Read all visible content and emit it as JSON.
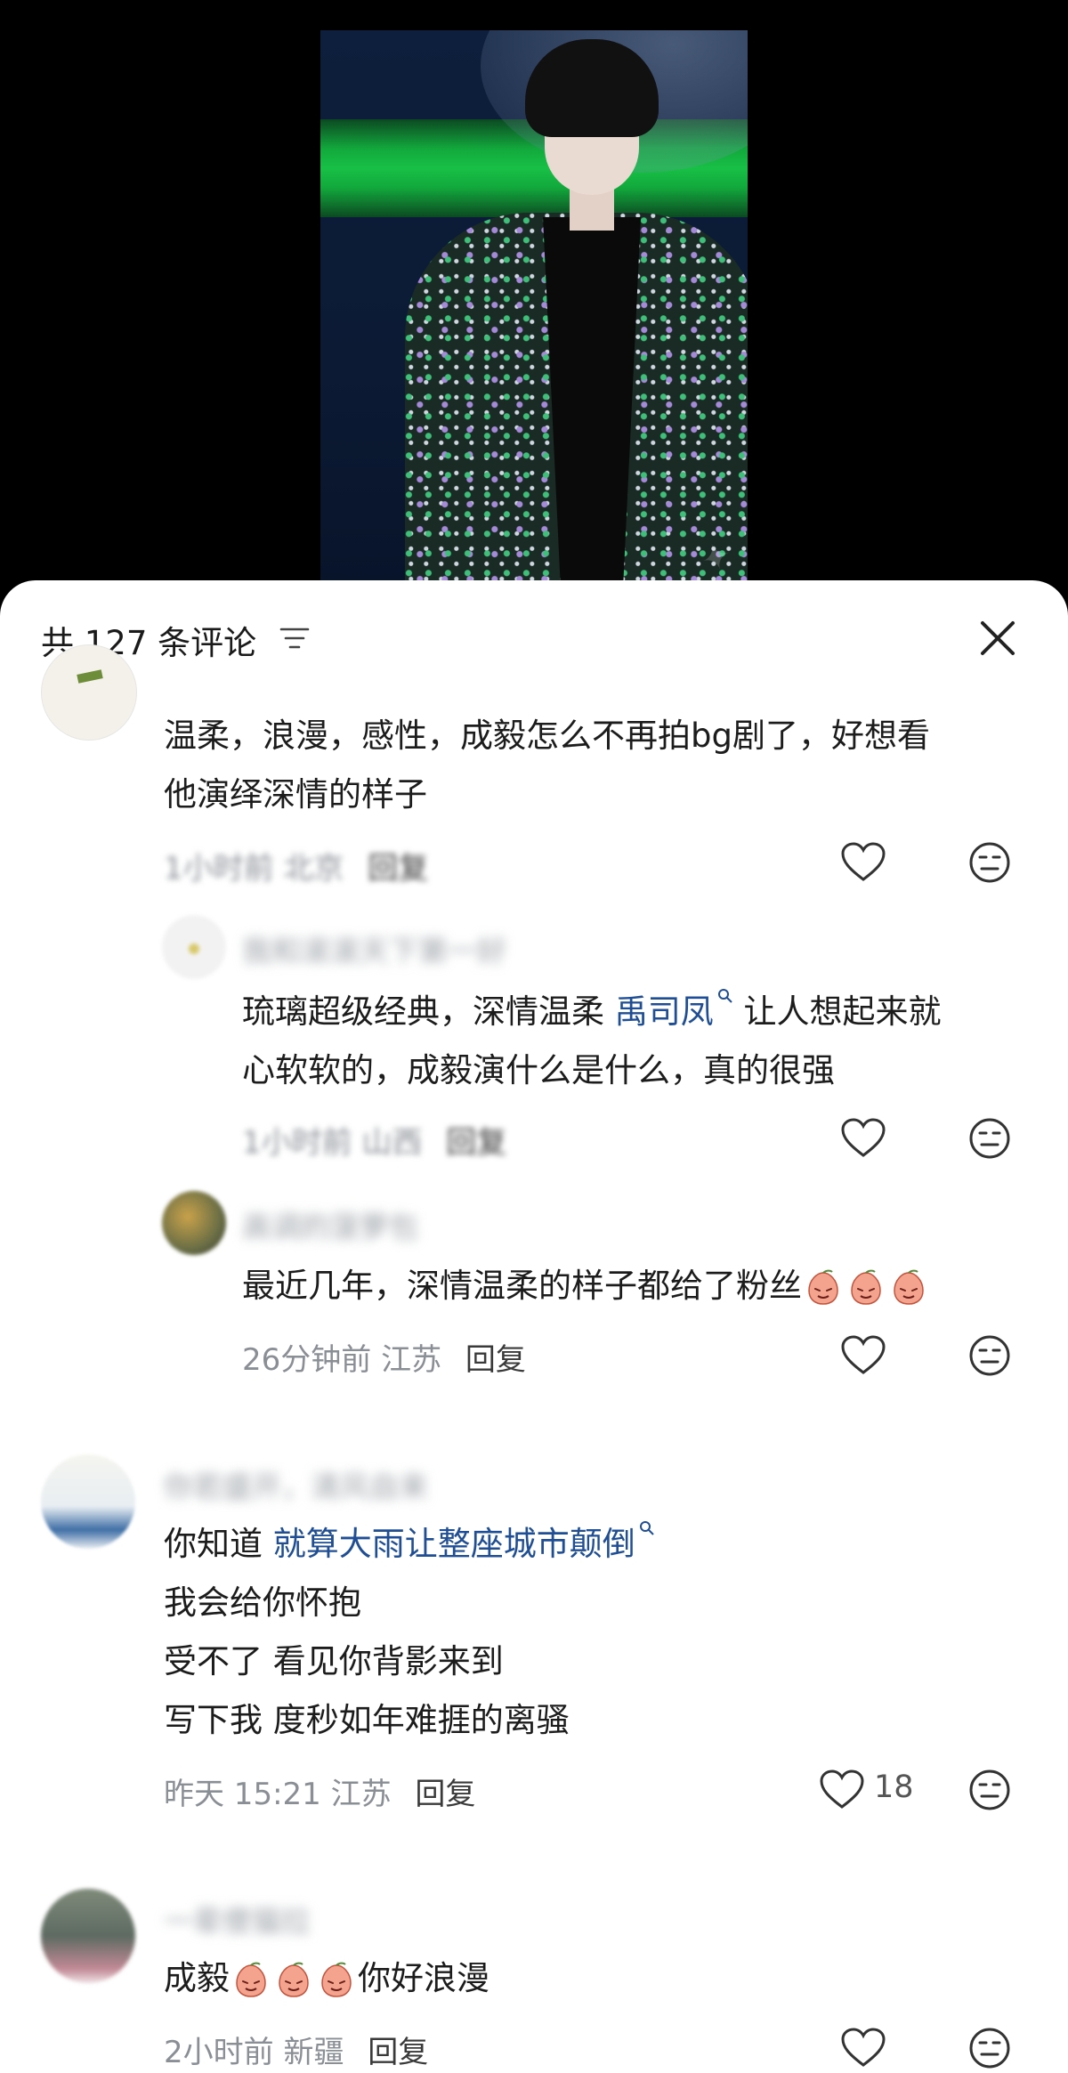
{
  "header": {
    "title": "共 127 条评论"
  },
  "comments": [
    {
      "name": "",
      "text": [
        "温柔，浪漫，感性，成毅怎么不再拍bg剧了，好想看",
        "他演绎深情的样子"
      ],
      "time": "1小时前",
      "location": "北京",
      "reply": "回复",
      "replies": [
        {
          "name": "我和滚滚天下第一好",
          "text_a": "琉璃超级经典，深情温柔 ",
          "link": "禹司凤",
          "text_b": " 让人想起来就",
          "text_line2": "心软软的，成毅演什么是什么，真的很强",
          "time": "1小时前",
          "location": "山西",
          "reply": "回复"
        },
        {
          "name": "高调的菠萝包",
          "text": "最近几年，深情温柔的样子都给了粉丝",
          "emoji_count": 3,
          "time": "26分钟前",
          "location": "江苏",
          "reply": "回复"
        }
      ]
    },
    {
      "name": "你若盛开，清风自来",
      "text_a": "你知道 ",
      "link": "就算大雨让整座城市颠倒",
      "lines": [
        "我会给你怀抱",
        "受不了 看见你背影来到",
        "写下我 度秒如年难捱的离骚"
      ],
      "time": "昨天 15:21",
      "location": "江苏",
      "reply": "回复",
      "likes": "18"
    },
    {
      "name": "一辈傻猫拉",
      "text_a": "成毅",
      "text_b": "你好浪漫",
      "time": "2小时前",
      "location": "新疆",
      "reply": "回复"
    }
  ]
}
